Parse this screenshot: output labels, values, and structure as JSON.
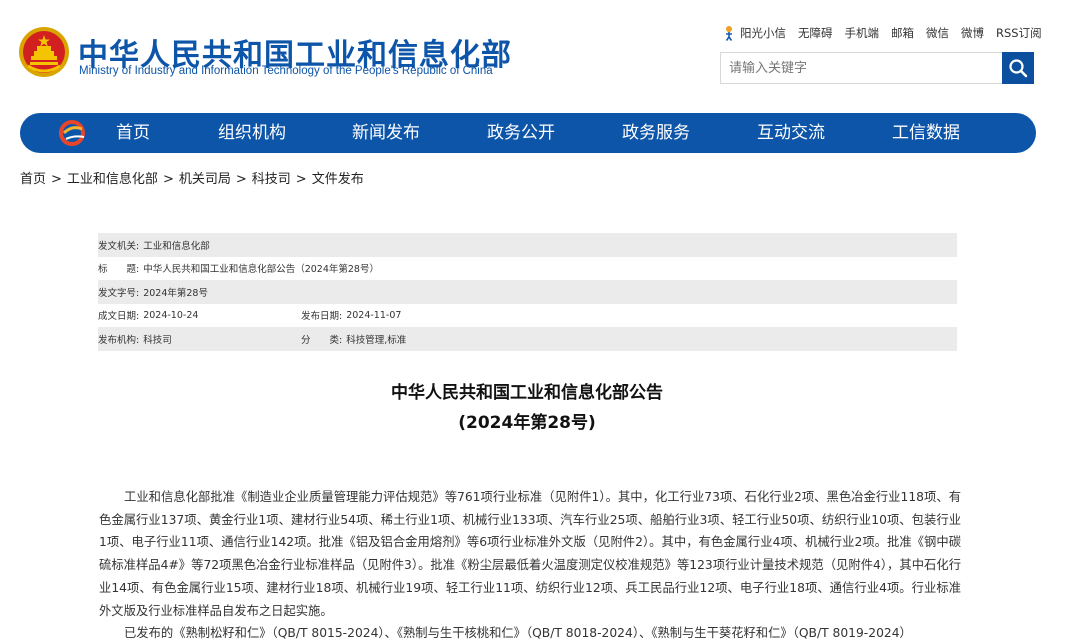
{
  "header": {
    "site_title_cn": "中华人民共和国工业和信息化部",
    "site_title_en": "Ministry of Industry and Information Technology of the People's Republic of China",
    "top_links": [
      "阳光小信",
      "无障碍",
      "手机端",
      "邮箱",
      "微信",
      "微博",
      "RSS订阅"
    ],
    "search_placeholder": "请输入关键字"
  },
  "nav": {
    "items": [
      "首页",
      "组织机构",
      "新闻发布",
      "政务公开",
      "政务服务",
      "互动交流",
      "工信数据"
    ]
  },
  "breadcrumb": [
    "首页",
    "工业和信息化部",
    "机关司局",
    "科技司",
    "文件发布"
  ],
  "meta": {
    "issuer_label": "发文机关:",
    "issuer": "工业和信息化部",
    "title_label": "标　　题:",
    "title": "中华人民共和国工业和信息化部公告（2024年第28号）",
    "doc_no_label": "发文字号:",
    "doc_no": "2024年第28号",
    "written_date_label": "成文日期:",
    "written_date": "2024-10-24",
    "publish_date_label": "发布日期:",
    "publish_date": "2024-11-07",
    "publisher_label": "发布机构:",
    "publisher": "科技司",
    "category_label": "分　　类:",
    "category": "科技管理,标准"
  },
  "article": {
    "title_line1": "中华人民共和国工业和信息化部公告",
    "title_line2": "(2024年第28号)",
    "paragraph1": "工业和信息化部批准《制造业企业质量管理能力评估规范》等761项行业标准（见附件1）。其中，化工行业73项、石化行业2项、黑色冶金行业118项、有色金属行业137项、黄金行业1项、建材行业54项、稀土行业1项、机械行业133项、汽车行业25项、船舶行业3项、轻工行业50项、纺织行业10项、包装行业1项、电子行业11项、通信行业142项。批准《铝及铝合金用熔剂》等6项行业标准外文版（见附件2）。其中，有色金属行业4项、机械行业2项。批准《钢中碳硫标准样品4#》等72项黑色冶金行业标准样品（见附件3）。批准《粉尘层最低着火温度测定仪校准规范》等123项行业计量技术规范（见附件4），其中石化行业14项、有色金属行业15项、建材行业18项、机械行业19项、轻工行业11项、纺织行业12项、兵工民品行业12项、电子行业18项、通信行业4项。行业标准外文版及行业标准样品自发布之日起实施。",
    "paragraph2": "已发布的《熟制松籽和仁》（QB/T 8015-2024）、《熟制与生干核桃和仁》（QB/T 8018-2024）、《熟制与生干葵花籽和仁》（QB/T 8019-2024）"
  },
  "colors": {
    "brand_blue": "#0d55a8",
    "search_button": "#0b4f9e",
    "meta_row_shade": "#ebebeb"
  }
}
